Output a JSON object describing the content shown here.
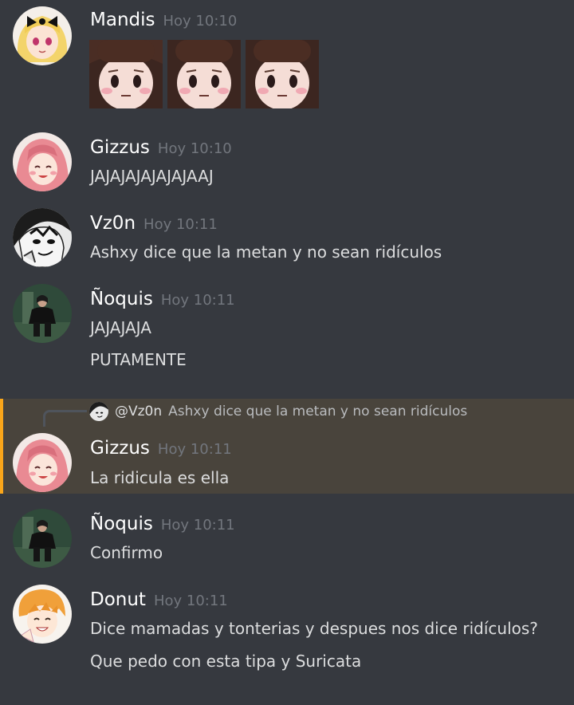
{
  "messages": [
    {
      "user": "Mandis",
      "time": "Hoy 10:10",
      "avatar": "anime-blonde-girl-avatar",
      "lines": [],
      "emojis": [
        "sad-face-emoji",
        "sad-face-emoji",
        "sad-face-emoji"
      ]
    },
    {
      "user": "Gizzus",
      "time": "Hoy 10:10",
      "avatar": "anime-pink-hair-avatar",
      "lines": [
        "JAJAJAJAJAJAJAAJ"
      ]
    },
    {
      "user": "Vz0n",
      "time": "Hoy 10:11",
      "avatar": "manga-bw-avatar",
      "lines": [
        "Ashxy dice que la metan y no sean ridículos"
      ]
    },
    {
      "user": "Ñoquis",
      "time": "Hoy 10:11",
      "avatar": "keanu-avatar",
      "lines": [
        "JAJAJAJA",
        "PUTAMENTE"
      ]
    },
    {
      "user": "Gizzus",
      "time": "Hoy 10:11",
      "avatar": "anime-pink-hair-avatar",
      "lines": [
        "La ridicula es ella"
      ],
      "reply": {
        "user": "@Vz0n",
        "text": "Ashxy dice que la metan y no sean ridículos"
      }
    },
    {
      "user": "Ñoquis",
      "time": "Hoy 10:11",
      "avatar": "keanu-avatar",
      "lines": [
        "Confirmo"
      ]
    },
    {
      "user": "Donut",
      "time": "Hoy 10:11",
      "avatar": "anime-orange-hair-avatar",
      "lines": [
        "Dice mamadas y tonterias y despues nos dice ridículos?",
        "Que pedo con esta tipa y Suricata"
      ]
    }
  ],
  "colors": {
    "background": "#36393f",
    "highlight": "#49443c",
    "mention_bar": "#faa61a",
    "username": "#ffffff",
    "timestamp": "#72767d",
    "text": "#dcddde"
  }
}
